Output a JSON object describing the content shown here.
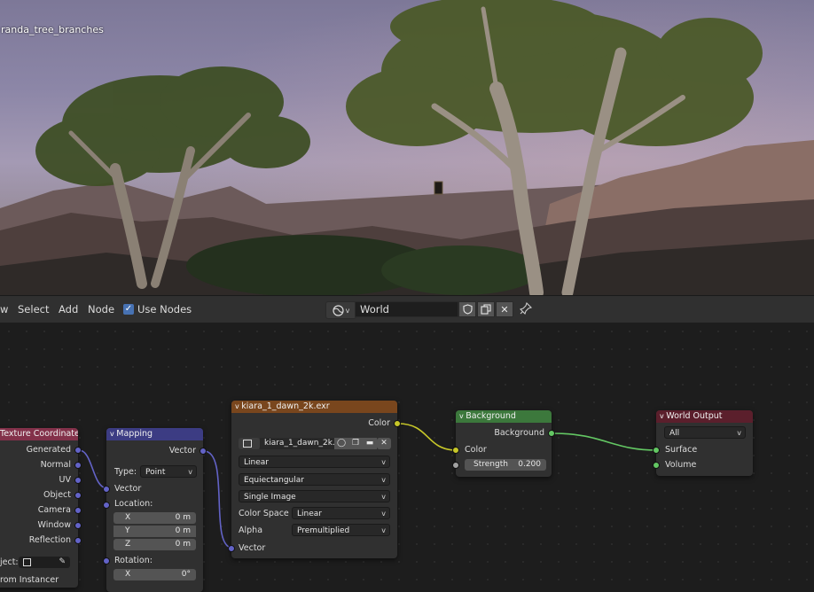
{
  "viewport": {
    "object_label": "randa_tree_branches"
  },
  "header": {
    "menu": [
      "w",
      "Select",
      "Add",
      "Node"
    ],
    "use_nodes_label": "Use Nodes",
    "world_name": "World"
  },
  "nodes": {
    "texcoord": {
      "title": "Texture Coordinate",
      "outputs": [
        "Generated",
        "Normal",
        "UV",
        "Object",
        "Camera",
        "Window",
        "Reflection"
      ],
      "object_label": "ject:",
      "from_instancer": "rom Instancer"
    },
    "mapping": {
      "title": "Mapping",
      "output": "Vector",
      "type_label": "Type:",
      "type_value": "Point",
      "input_vector": "Vector",
      "location_label": "Location:",
      "loc": [
        {
          "axis": "X",
          "value": "0 m"
        },
        {
          "axis": "Y",
          "value": "0 m"
        },
        {
          "axis": "Z",
          "value": "0 m"
        }
      ],
      "rotation_label": "Rotation:",
      "rot_x": {
        "axis": "X",
        "value": "0°"
      }
    },
    "image": {
      "title": "kiara_1_dawn_2k.exr",
      "output": "Color",
      "image_name": "kiara_1_dawn_2k...",
      "interpolation": "Linear",
      "projection": "Equiectangular",
      "source": "Single Image",
      "color_space_label": "Color Space",
      "color_space": "Linear",
      "alpha_label": "Alpha",
      "alpha": "Premultiplied",
      "input_vector": "Vector"
    },
    "background": {
      "title": "Background",
      "output": "Background",
      "input_color": "Color",
      "strength_label": "Strength",
      "strength_value": "0.200"
    },
    "world_output": {
      "title": "World Output",
      "target": "All",
      "surface": "Surface",
      "volume": "Volume"
    }
  },
  "colors": {
    "texcoord_header": "#83314a",
    "mapping_header": "#3c3c83",
    "image_header": "#79461d",
    "background_header": "#3c783c",
    "world_output_header": "#5b1f2c",
    "color_link": "#c7c729",
    "shader_link": "#63c763",
    "vector_link": "#6363c7"
  }
}
